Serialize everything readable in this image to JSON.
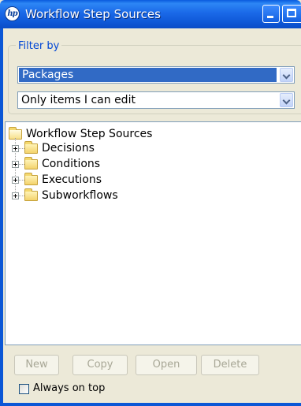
{
  "window": {
    "title": "Workflow Step Sources",
    "logo_text": "hp",
    "title_bar_color": "#0A5BDD"
  },
  "filter": {
    "legend": "Filter by",
    "type_select": {
      "value": "Packages",
      "selected": true
    },
    "scope_select": {
      "value": "Only items I can edit"
    }
  },
  "tree": {
    "root": {
      "label": "Workflow Step Sources",
      "icon": "folder-open-icon"
    },
    "children": [
      {
        "label": "Decisions",
        "icon": "folder-icon"
      },
      {
        "label": "Conditions",
        "icon": "folder-icon"
      },
      {
        "label": "Executions",
        "icon": "folder-icon"
      },
      {
        "label": "Subworkflows",
        "icon": "folder-icon"
      }
    ]
  },
  "buttons": {
    "new": "New",
    "copy": "Copy",
    "open": "Open",
    "delete": "Delete"
  },
  "always_on_top": {
    "label": "Always on top",
    "checked": false
  }
}
